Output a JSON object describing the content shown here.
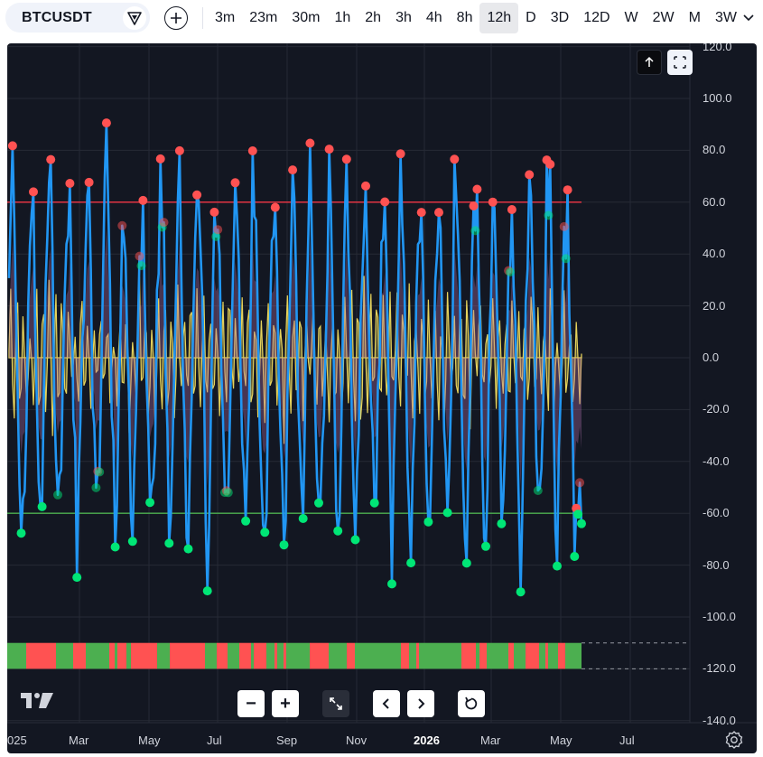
{
  "toolbar": {
    "symbol": "BTCUSDT",
    "intervals": [
      "3m",
      "23m",
      "30m",
      "1h",
      "2h",
      "3h",
      "4h",
      "8h",
      "12h",
      "D",
      "3D",
      "12D",
      "W",
      "2W",
      "M",
      "3W"
    ],
    "active_interval": "12h"
  },
  "chart": {
    "price_axis": [
      "120.0",
      "100.0",
      "80.0",
      "60.0",
      "40.0",
      "20.0",
      "0.0",
      "-20.0",
      "-40.0",
      "-60.0",
      "-80.0",
      "-100.0",
      "-120.0",
      "-140.0"
    ],
    "time_axis": [
      "025",
      "Mar",
      "May",
      "Jul",
      "Sep",
      "Nov",
      "2026",
      "Mar",
      "May",
      "Jul"
    ],
    "time_axis_bold": "2026",
    "overbought_level": 60,
    "oversold_level": -60,
    "colors": {
      "background": "#131722",
      "wave": "#2196f3",
      "histogram": "#e6d35c",
      "overbought_line": "#f23645",
      "oversold_line": "#4caf50",
      "bear_dot": "#ff5252",
      "bull_dot": "#00e676",
      "band_red": "#ff5252",
      "band_green": "#4caf50"
    },
    "zoom_controls": {
      "zoom_out": "−",
      "zoom_in": "+"
    }
  }
}
